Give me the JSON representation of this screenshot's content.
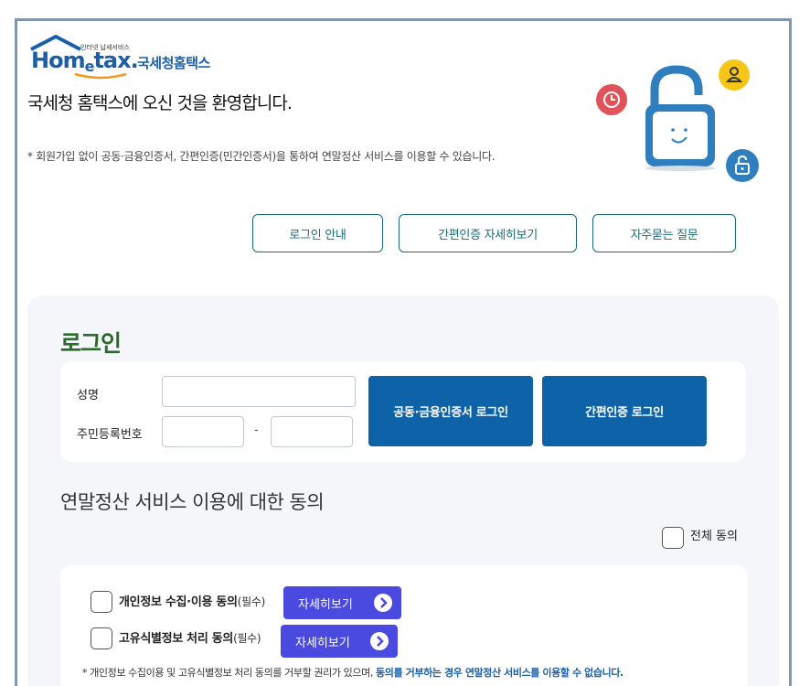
{
  "logo": {
    "tagline": "인터넷 납세서비스",
    "brand_prefix": "Hom",
    "brand_e": "e",
    "brand_suffix": "tax.",
    "korean_name": "국세청홈택스"
  },
  "header": {
    "welcome": "국세청 홈택스에 오신 것을 환영합니다.",
    "notice": "* 회원가입 없이 공동·금융인증서, 간편인증(민간인증서)을 통하여 연말정산 서비스를 이용할 수 있습니다."
  },
  "hero_icons": [
    "clock-icon",
    "user-icon",
    "padlock-icon",
    "unlock-icon"
  ],
  "help_links": {
    "login_guide": "로그인 안내",
    "simple_auth_detail": "간편인증 자세히보기",
    "faq": "자주묻는 질문"
  },
  "login": {
    "title": "로그인",
    "name_label": "성명",
    "rrn_label": "주민등록번호",
    "rrn_separator": "-",
    "cert_login_button": "공동·금융인증서 로그인",
    "simple_login_button": "간편인증 로그인"
  },
  "consent": {
    "title": "연말정산 서비스 이용에 대한 동의",
    "agree_all_label": "전체 동의",
    "items": [
      {
        "label": "개인정보 수집·이용 동의",
        "required": "(필수)",
        "detail_button": "자세히보기"
      },
      {
        "label": "고유식별정보 처리 동의",
        "required": "(필수)",
        "detail_button": "자세히보기"
      }
    ],
    "footnote_prefix": "* 개인정보 수집이용 및 고유식별정보 처리 동의를 거부할 권리가 있으며, ",
    "footnote_emphasis": "동의를 거부하는 경우 연말정산 서비스를 이용할 수 없습니다."
  },
  "colors": {
    "frame_border": "#7f96ad",
    "brand_blue": "#1a5fa8",
    "login_button": "#0d62a8",
    "detail_button": "#4a4ae0",
    "outline_button": "#1a6a7a",
    "login_title": "#2a6a2a",
    "panel_bg": "#f5f6fa"
  }
}
